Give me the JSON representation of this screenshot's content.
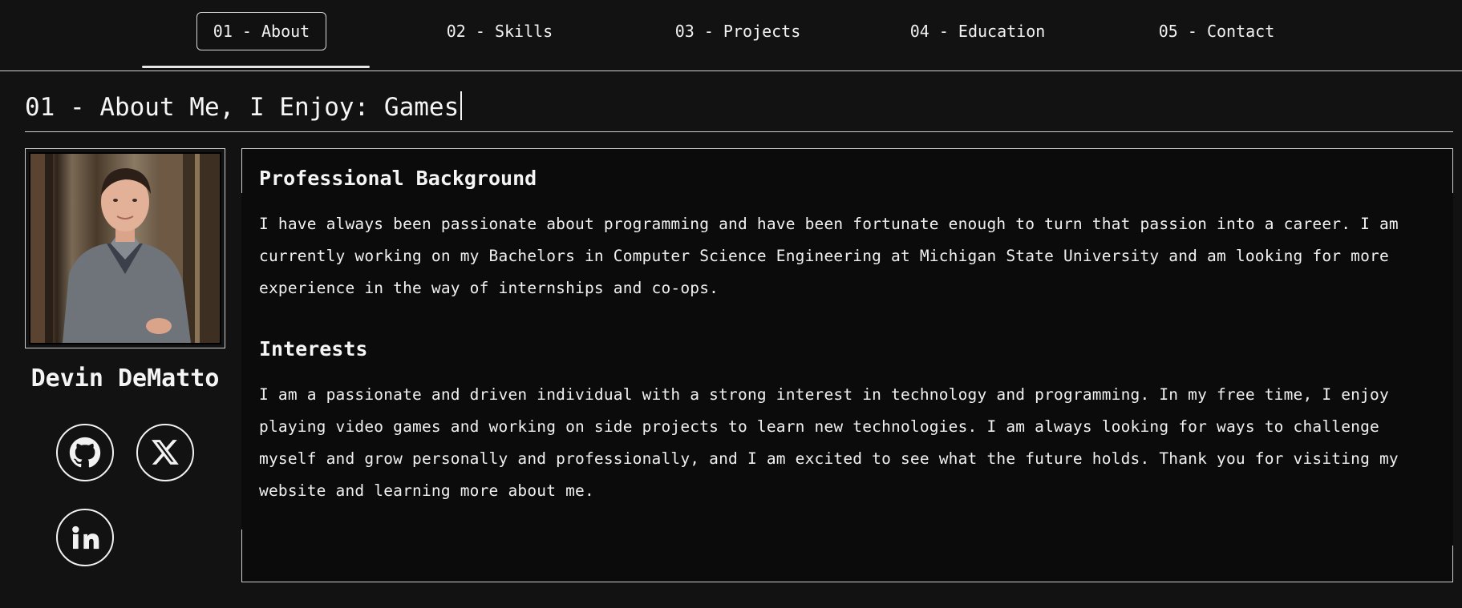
{
  "nav": {
    "tabs": [
      {
        "label": "01 - About",
        "active": true
      },
      {
        "label": "02 - Skills",
        "active": false
      },
      {
        "label": "03 - Projects",
        "active": false
      },
      {
        "label": "04 - Education",
        "active": false
      },
      {
        "label": "05 - Contact",
        "active": false
      }
    ]
  },
  "heading": {
    "text": "01 - About Me, I Enjoy: Games"
  },
  "profile": {
    "name": "Devin DeMatto",
    "socials": [
      {
        "icon": "github-icon"
      },
      {
        "icon": "x-icon"
      },
      {
        "icon": "linkedin-icon"
      }
    ]
  },
  "about": {
    "sections": [
      {
        "title": "Professional Background",
        "body": "I have always been passionate about programming and have been fortunate enough to turn that passion into a career. I am currently working on my Bachelors in Computer Science Engineering at Michigan State University and am looking for more experience in the way of internships and co-ops."
      },
      {
        "title": "Interests",
        "body": "I am a passionate and driven individual with a strong interest in technology and programming. In my free time, I enjoy playing video games and working on side projects to learn new technologies. I am always looking for ways to challenge myself and grow personally and professionally, and I am excited to see what the future holds. Thank you for visiting my website and learning more about me."
      }
    ]
  },
  "colors": {
    "background": "#121212",
    "card": "#0b0b0b",
    "text": "#f2f2f2",
    "border": "#cfcfcf"
  }
}
